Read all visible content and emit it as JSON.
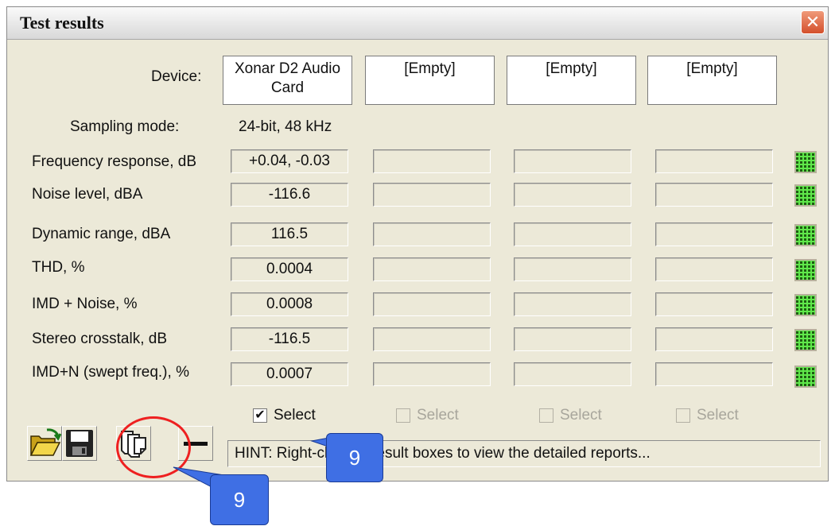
{
  "window": {
    "title": "Test results",
    "close_glyph": "✕"
  },
  "device_label": "Device:",
  "devices": [
    "Xonar D2 Audio Card",
    "[Empty]",
    "[Empty]",
    "[Empty]"
  ],
  "sampling": {
    "label": "Sampling mode:",
    "value": "24-bit, 48 kHz"
  },
  "rows": [
    {
      "label": "Frequency response, dB",
      "values": [
        "+0.04, -0.03",
        "",
        "",
        ""
      ]
    },
    {
      "label": "Noise level, dBA",
      "values": [
        "-116.6",
        "",
        "",
        ""
      ]
    },
    {
      "label": "Dynamic range, dBA",
      "values": [
        "116.5",
        "",
        "",
        ""
      ]
    },
    {
      "label": "THD, %",
      "values": [
        "0.0004",
        "",
        "",
        ""
      ]
    },
    {
      "label": "IMD + Noise, %",
      "values": [
        "0.0008",
        "",
        "",
        ""
      ]
    },
    {
      "label": "Stereo crosstalk, dB",
      "values": [
        "-116.5",
        "",
        "",
        ""
      ]
    },
    {
      "label": "IMD+N (swept freq.), %",
      "values": [
        "0.0007",
        "",
        "",
        ""
      ]
    }
  ],
  "select": {
    "label": "Select",
    "checked": [
      true,
      false,
      false,
      false
    ],
    "check_glyph": "✔"
  },
  "toolbar": {
    "icons": [
      "folder-open-icon",
      "save-disk-icon",
      "copy-pages-icon",
      "minus-icon"
    ]
  },
  "hint": "HINT: Right-click on result boxes to view the detailed reports...",
  "callouts": [
    "9",
    "9"
  ],
  "colors": {
    "window_bg": "#ece9d8",
    "close_red": "#d4502c",
    "graph_green": "#5fe84a",
    "callout_blue": "#3f6fe4",
    "highlight_red": "#ee2020"
  }
}
